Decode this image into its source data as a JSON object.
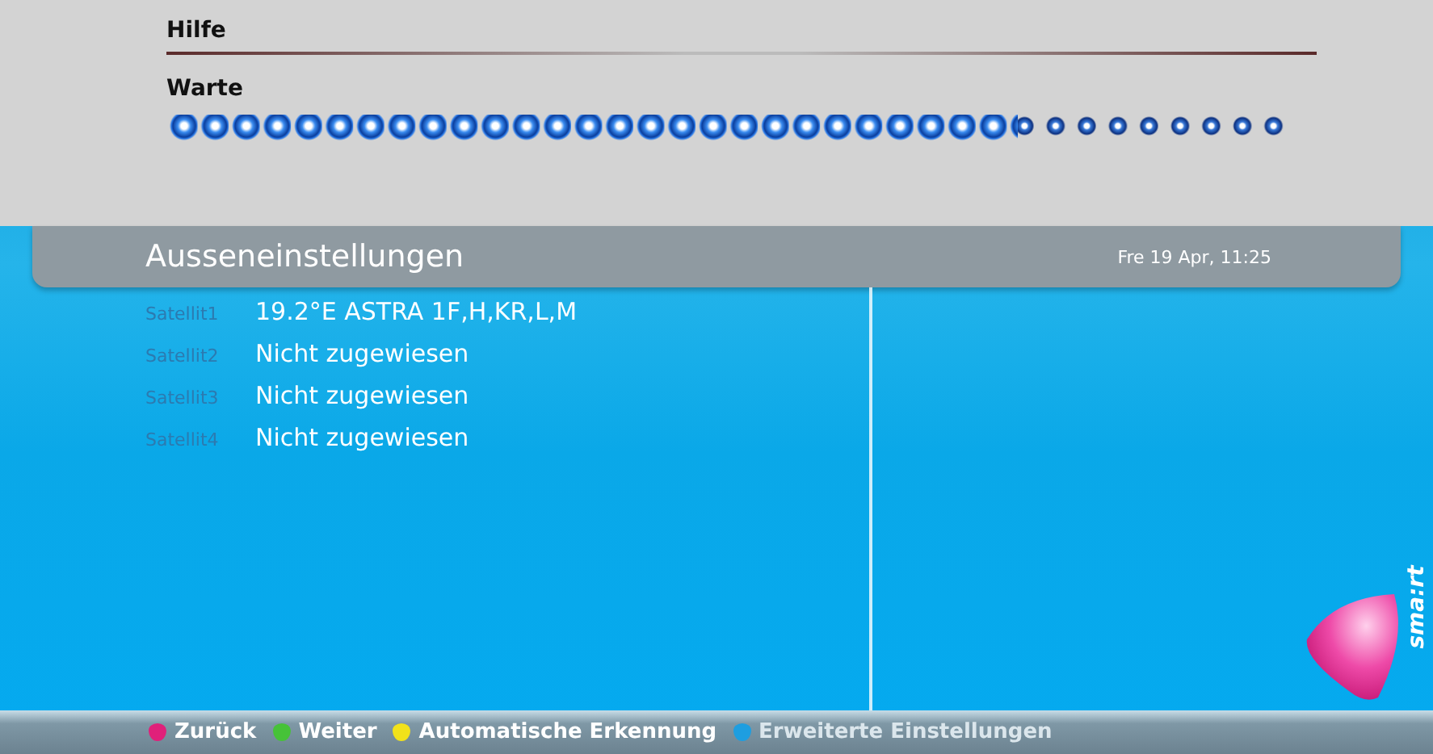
{
  "help_panel": {
    "title": "Hilfe",
    "status": "Warte",
    "progress": {
      "level": 0.76
    }
  },
  "header": {
    "title": "Ausseneinstellungen",
    "datetime": "Fre 19 Apr, 11:25"
  },
  "satellites": [
    {
      "label": "Satellit1",
      "value": "19.2°E ASTRA 1F,H,KR,L,M"
    },
    {
      "label": "Satellit2",
      "value": "Nicht zugewiesen"
    },
    {
      "label": "Satellit3",
      "value": "Nicht zugewiesen"
    },
    {
      "label": "Satellit4",
      "value": "Nicht zugewiesen"
    }
  ],
  "logo": {
    "text": "sma:rt"
  },
  "key_legend": [
    {
      "label": "Zurück",
      "color": "#e0207a",
      "disabled": false
    },
    {
      "label": "Weiter",
      "color": "#46c238",
      "disabled": false
    },
    {
      "label": "Automatische Erkennung",
      "color": "#f2e21a",
      "disabled": false
    },
    {
      "label": "Erweiterte Einstellungen",
      "color": "#1e9ee0",
      "disabled": true
    }
  ]
}
